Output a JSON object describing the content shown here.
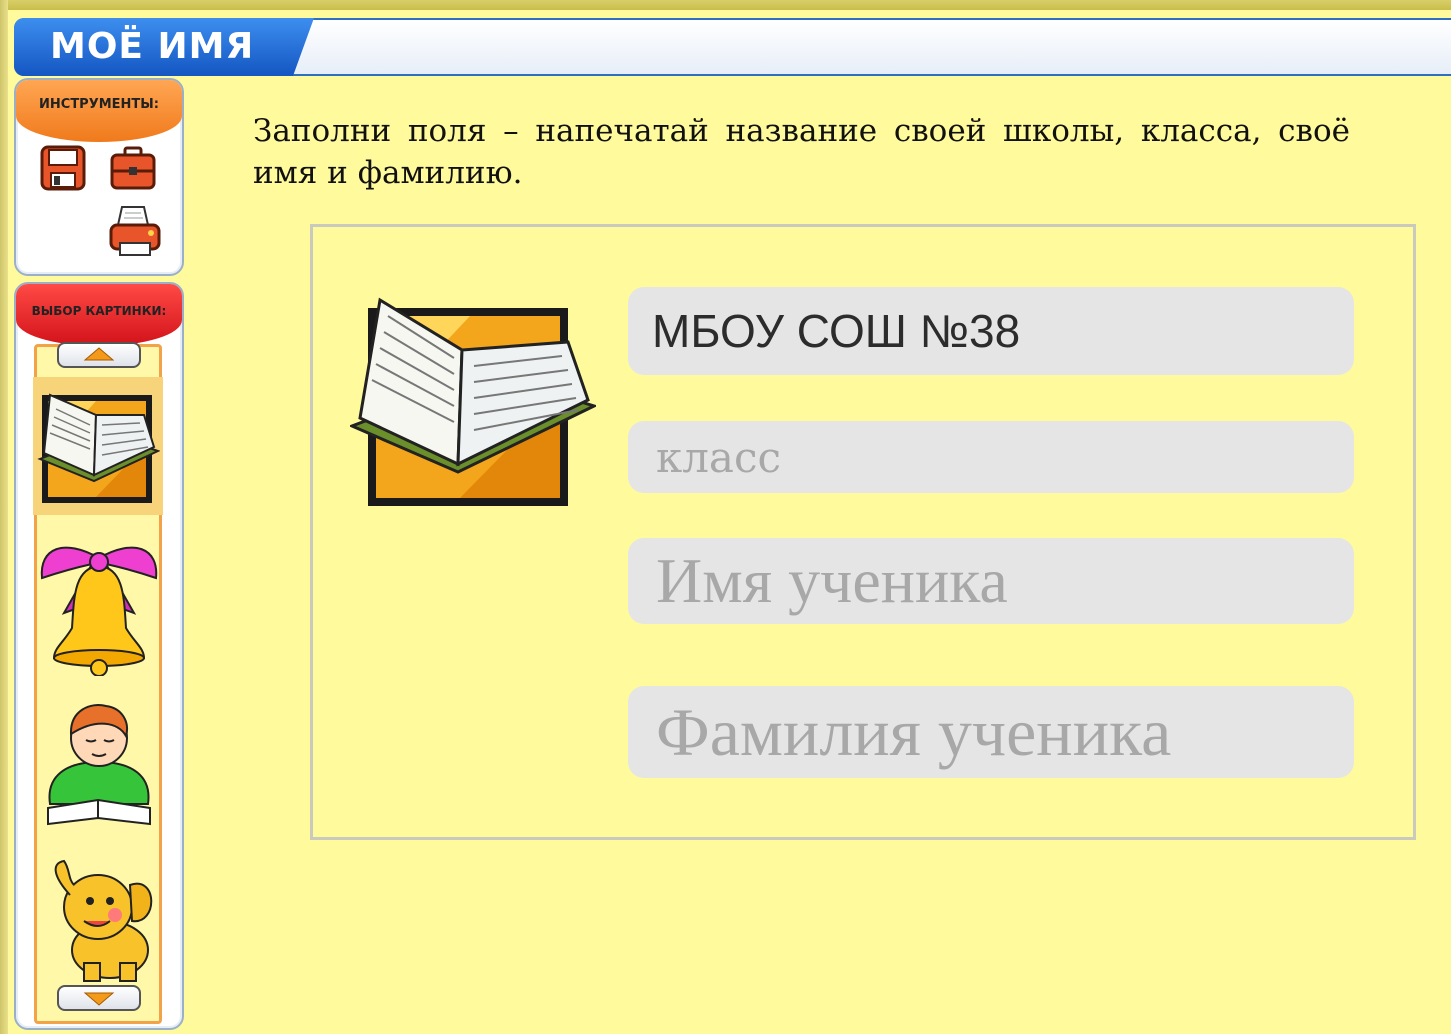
{
  "header": {
    "title": "МОЁ ИМЯ"
  },
  "tools_panel": {
    "title": "ИНСТРУМЕНТЫ:",
    "tools": [
      {
        "icon": "floppy-disk-icon"
      },
      {
        "icon": "briefcase-icon"
      },
      {
        "icon": "printer-icon"
      }
    ]
  },
  "picture_panel": {
    "title": "ВЫБОР КАРТИНКИ:",
    "pictures": [
      {
        "icon": "open-book-icon",
        "selected": true
      },
      {
        "icon": "bell-with-bow-icon"
      },
      {
        "icon": "boy-reading-icon"
      },
      {
        "icon": "elephant-icon"
      }
    ]
  },
  "instruction": "Заполни поля – напечатай название своей школы, класса, своё имя и фамилию.",
  "form": {
    "school": {
      "value": "МБОУ СОШ №38",
      "placeholder": ""
    },
    "class": {
      "value": "",
      "placeholder": "класс"
    },
    "name": {
      "value": "",
      "placeholder": "Имя ученика"
    },
    "surname": {
      "value": "",
      "placeholder": "Фамилия ученика"
    }
  },
  "colors": {
    "background": "#fffb9c",
    "title_blue": "#1f6ad8",
    "tools_header": "#f58a2c",
    "picture_header": "#e3262a"
  }
}
